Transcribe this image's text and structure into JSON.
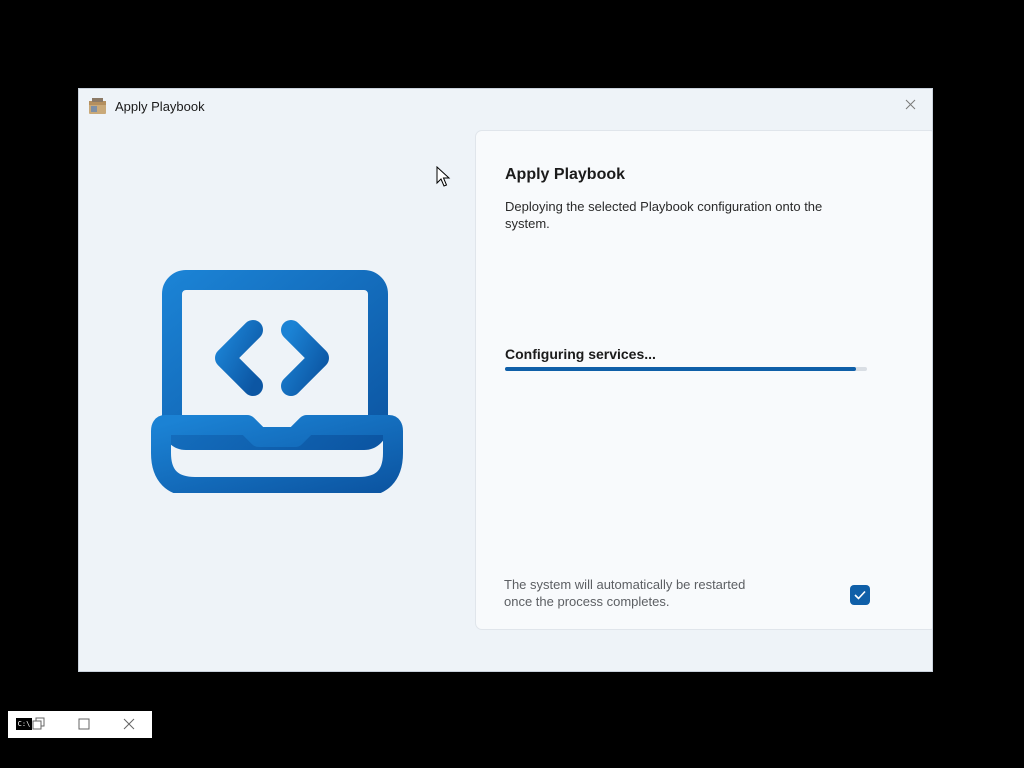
{
  "window": {
    "title": "Apply Playbook",
    "icon": "playbook-box-icon",
    "close_icon": "close-icon"
  },
  "hero": {
    "icon": "laptop-code-icon",
    "color": "#0f62b0"
  },
  "panel": {
    "title": "Apply Playbook",
    "description": "Deploying the selected Playbook configuration onto the system.",
    "status": "Configuring services...",
    "progress": 0.97,
    "restart_note": "The system will automatically be restarted once the process completes.",
    "restart_checkbox_checked": true
  },
  "taskbar": {
    "cmd_label": "C:\\",
    "icons": [
      "console-icon",
      "restore-icon",
      "maximize-icon",
      "close-icon"
    ]
  },
  "colors": {
    "accent": "#0f5fa8",
    "window_bg": "#eef3f8",
    "panel_bg": "#f8fafc"
  }
}
